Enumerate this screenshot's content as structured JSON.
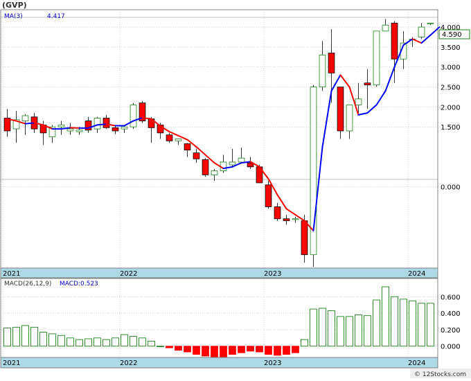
{
  "colors": {
    "up": "#1a7f1a",
    "down": "#ff0000",
    "ma_up": "#0000ff",
    "ma_down": "#ff0000",
    "macd_bar": "#1a7f1a",
    "macd_neg": "#ff0000",
    "grid": "#a0a0a0",
    "axis_band": "#add8e6",
    "title": "#333333",
    "legend_blue": "#0000cc"
  },
  "header": {
    "symbol": "(GVP)",
    "ma_label": "MA(3)",
    "ma_value": "4.417"
  },
  "macd_header": {
    "label": "MACD(26,12,9)",
    "value_label": "MACD:0.523"
  },
  "footer": {
    "credit": "© 12Stocks.com"
  },
  "chart_data": [
    {
      "type": "candlestick",
      "name": "price",
      "last_price_label": "4.590",
      "y_tick_labels": [
        "4.000",
        "3.500",
        "3.000",
        "2.500",
        "2.000",
        "1.500",
        "0.000"
      ],
      "x_tick_labels": [
        "2021",
        "2022",
        "2023",
        "2024"
      ],
      "x_tick_positions": [
        0,
        13,
        29,
        45
      ],
      "candles": [
        {
          "o": 1.72,
          "h": 1.95,
          "l": 1.25,
          "c": 1.4
        },
        {
          "o": 1.45,
          "h": 1.9,
          "l": 1.1,
          "c": 1.68
        },
        {
          "o": 1.65,
          "h": 1.82,
          "l": 1.3,
          "c": 1.78
        },
        {
          "o": 1.75,
          "h": 1.85,
          "l": 1.35,
          "c": 1.45
        },
        {
          "o": 1.55,
          "h": 1.65,
          "l": 1.05,
          "c": 1.35
        },
        {
          "o": 1.25,
          "h": 1.55,
          "l": 1.1,
          "c": 1.5
        },
        {
          "o": 1.5,
          "h": 1.65,
          "l": 1.3,
          "c": 1.55
        },
        {
          "o": 1.4,
          "h": 1.6,
          "l": 1.3,
          "c": 1.45
        },
        {
          "o": 1.38,
          "h": 1.5,
          "l": 1.3,
          "c": 1.42
        },
        {
          "o": 1.65,
          "h": 1.75,
          "l": 1.35,
          "c": 1.42
        },
        {
          "o": 1.45,
          "h": 1.75,
          "l": 1.35,
          "c": 1.72
        },
        {
          "o": 1.72,
          "h": 1.8,
          "l": 1.45,
          "c": 1.48
        },
        {
          "o": 1.48,
          "h": 1.55,
          "l": 1.32,
          "c": 1.4
        },
        {
          "o": 1.45,
          "h": 1.55,
          "l": 1.35,
          "c": 1.5
        },
        {
          "o": 1.5,
          "h": 2.1,
          "l": 1.45,
          "c": 2.05
        },
        {
          "o": 2.1,
          "h": 2.15,
          "l": 1.6,
          "c": 1.65
        },
        {
          "o": 1.7,
          "h": 1.75,
          "l": 1.1,
          "c": 1.48
        },
        {
          "o": 1.55,
          "h": 1.6,
          "l": 1.2,
          "c": 1.35
        },
        {
          "o": 1.3,
          "h": 1.35,
          "l": 1.1,
          "c": 1.15
        },
        {
          "o": 1.15,
          "h": 1.2,
          "l": 1.05,
          "c": 1.2
        },
        {
          "o": 1.08,
          "h": 1.1,
          "l": 0.75,
          "c": 0.92
        },
        {
          "o": 0.85,
          "h": 0.95,
          "l": 0.6,
          "c": 0.7
        },
        {
          "o": 0.68,
          "h": 0.72,
          "l": 0.25,
          "c": 0.3
        },
        {
          "o": 0.3,
          "h": 0.45,
          "l": 0.15,
          "c": 0.4
        },
        {
          "o": 0.4,
          "h": 0.8,
          "l": 0.35,
          "c": 0.62
        },
        {
          "o": 0.55,
          "h": 0.95,
          "l": 0.5,
          "c": 0.62
        },
        {
          "o": 0.62,
          "h": 0.98,
          "l": 0.58,
          "c": 0.72
        },
        {
          "o": 0.6,
          "h": 0.75,
          "l": 0.45,
          "c": 0.5
        },
        {
          "o": 0.5,
          "h": 0.55,
          "l": 0.1,
          "c": 0.1
        },
        {
          "o": 0.05,
          "h": 0.15,
          "l": -0.55,
          "c": -0.5
        },
        {
          "o": -0.5,
          "h": -0.4,
          "l": -0.85,
          "c": -0.8
        },
        {
          "o": -0.8,
          "h": -0.7,
          "l": -0.95,
          "c": -0.85
        },
        {
          "o": -0.82,
          "h": -0.75,
          "l": -0.9,
          "c": -0.8
        },
        {
          "o": -0.85,
          "h": -0.7,
          "l": -1.9,
          "c": -1.7
        },
        {
          "o": -1.7,
          "h": 2.55,
          "l": -2.0,
          "c": 2.5
        },
        {
          "o": 2.5,
          "h": 3.65,
          "l": 2.4,
          "c": 3.3
        },
        {
          "o": 3.35,
          "h": 3.95,
          "l": 2.1,
          "c": 2.85
        },
        {
          "o": 2.5,
          "h": 2.5,
          "l": 1.2,
          "c": 1.4
        },
        {
          "o": 1.4,
          "h": 1.7,
          "l": 1.2,
          "c": 2.05
        },
        {
          "o": 2.05,
          "h": 2.6,
          "l": 1.85,
          "c": 2.2
        },
        {
          "o": 2.6,
          "h": 2.95,
          "l": 1.95,
          "c": 2.55
        },
        {
          "o": 2.55,
          "h": 2.9,
          "l": 2.5,
          "c": 3.9
        },
        {
          "o": 3.9,
          "h": 4.2,
          "l": 3.9,
          "c": 4.05
        },
        {
          "o": 4.1,
          "h": 4.15,
          "l": 2.6,
          "c": 3.2
        },
        {
          "o": 3.2,
          "h": 3.9,
          "l": 2.95,
          "c": 3.6
        },
        {
          "o": 3.7,
          "h": 3.75,
          "l": 3.5,
          "c": 3.7
        },
        {
          "o": 3.75,
          "h": 4.1,
          "l": 3.7,
          "c": 4.0
        },
        {
          "o": 4.1,
          "h": 4.1,
          "l": 4.05,
          "c": 4.1
        }
      ],
      "ma3": [
        1.7,
        1.65,
        1.58,
        1.6,
        1.55,
        1.45,
        1.45,
        1.48,
        1.47,
        1.47,
        1.55,
        1.57,
        1.53,
        1.53,
        1.65,
        1.73,
        1.7,
        1.52,
        1.38,
        1.28,
        1.18,
        1.0,
        0.8,
        0.6,
        0.46,
        0.5,
        0.6,
        0.63,
        0.5,
        0.2,
        -0.2,
        -0.55,
        -0.7,
        -0.85,
        -1.1,
        1.0,
        2.4,
        2.8,
        2.5,
        1.8,
        1.85,
        2.05,
        2.4,
        3.0,
        3.55,
        3.7,
        3.6,
        3.8,
        4.0
      ],
      "ylim": [
        -2.0,
        4.4
      ]
    },
    {
      "type": "bar",
      "name": "MACD",
      "y_tick_labels": [
        "0.600",
        "0.400",
        "0.200",
        "0.000"
      ],
      "y_ticks": [
        0.6,
        0.4,
        0.2,
        0.0
      ],
      "x_tick_labels": [
        "2021",
        "2022",
        "2023",
        "2024"
      ],
      "ylim": [
        -0.12,
        0.72
      ],
      "values": [
        0.22,
        0.23,
        0.25,
        0.23,
        0.17,
        0.15,
        0.13,
        0.1,
        0.08,
        0.09,
        0.1,
        0.08,
        0.1,
        0.14,
        0.12,
        0.1,
        0.06,
        0.0,
        -0.02,
        -0.05,
        -0.07,
        -0.1,
        -0.12,
        -0.15,
        -0.13,
        -0.1,
        -0.08,
        -0.06,
        -0.07,
        -0.1,
        -0.11,
        -0.1,
        -0.08,
        0.08,
        0.45,
        0.46,
        0.43,
        0.36,
        0.36,
        0.38,
        0.37,
        0.56,
        0.72,
        0.6,
        0.57,
        0.55,
        0.52,
        0.52
      ]
    }
  ]
}
